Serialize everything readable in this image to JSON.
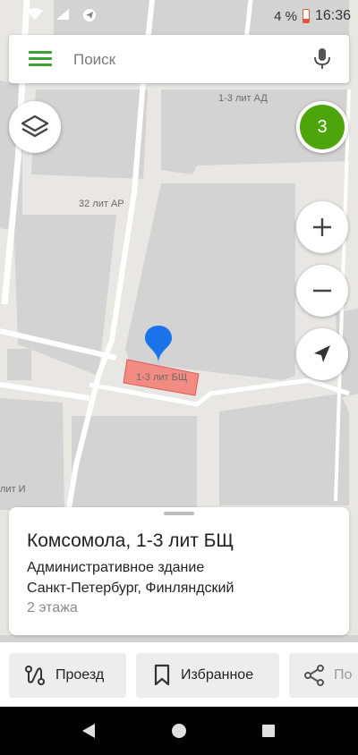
{
  "status": {
    "battery": "4 %",
    "time": "16:36"
  },
  "search": {
    "placeholder": "Поиск"
  },
  "map": {
    "labels": [
      "1-3 лит АД",
      "32 лит АР",
      "1-3 лит БЩ",
      "лит И"
    ],
    "results_count": "3"
  },
  "card": {
    "title": "Комсомола, 1-3 лит БЩ",
    "type": "Административное здание",
    "address": "Санкт-Петербург, Финляндский",
    "floors": "2 этажа"
  },
  "actions": {
    "route": "Проезд",
    "favorites": "Избранное",
    "share": "По"
  },
  "colors": {
    "accent": "#3ba135",
    "counter": "#4ea40b",
    "pin": "#1a73e8",
    "highlight": "#f28b82"
  }
}
